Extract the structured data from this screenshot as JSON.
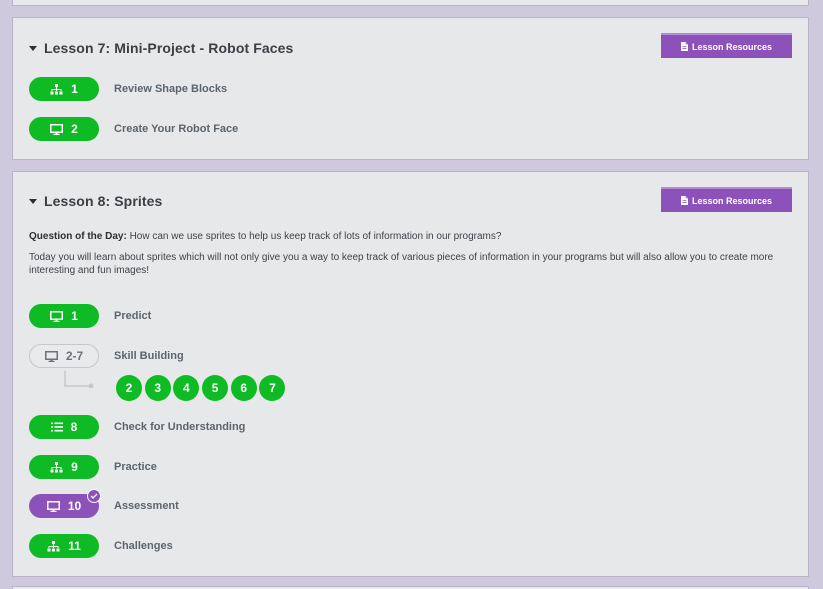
{
  "lessons": [
    {
      "title": "Lesson 7: Mini-Project - Robot Faces",
      "resources_label": "Lesson Resources",
      "levels": [
        {
          "icon": "hierarchy-icon",
          "number": "1",
          "name": "Review Shape Blocks",
          "state": "complete"
        },
        {
          "icon": "monitor-icon",
          "number": "2",
          "name": "Create Your Robot Face",
          "state": "complete"
        }
      ]
    },
    {
      "title": "Lesson 8: Sprites",
      "resources_label": "Lesson Resources",
      "question_label": "Question of the Day:",
      "question_text": " How can we use sprites to help us keep track of lots of information in our programs?",
      "description": "Today you will learn about sprites which will not only give you a way to keep track of various pieces of information in your programs but will also allow you to create more interesting and fun images!",
      "levels": [
        {
          "icon": "monitor-icon",
          "number": "1",
          "name": "Predict",
          "state": "complete"
        },
        {
          "icon": "monitor-icon",
          "number": "2-7",
          "name": "Skill Building",
          "state": "not-started",
          "sublevels": [
            "2",
            "3",
            "4",
            "5",
            "6",
            "7"
          ]
        },
        {
          "icon": "list-icon",
          "number": "8",
          "name": "Check for Understanding",
          "state": "complete"
        },
        {
          "icon": "hierarchy-icon",
          "number": "9",
          "name": "Practice",
          "state": "complete"
        },
        {
          "icon": "monitor-icon",
          "number": "10",
          "name": "Assessment",
          "state": "assessment-submitted"
        },
        {
          "icon": "hierarchy-icon",
          "number": "11",
          "name": "Challenges",
          "state": "complete"
        }
      ]
    }
  ],
  "colors": {
    "complete": "#0ebb25",
    "assessment": "#8c52ba",
    "resources_button": "#8c52ba",
    "page_background": "#cfc9dd",
    "card_background": "#e7e8ea"
  }
}
